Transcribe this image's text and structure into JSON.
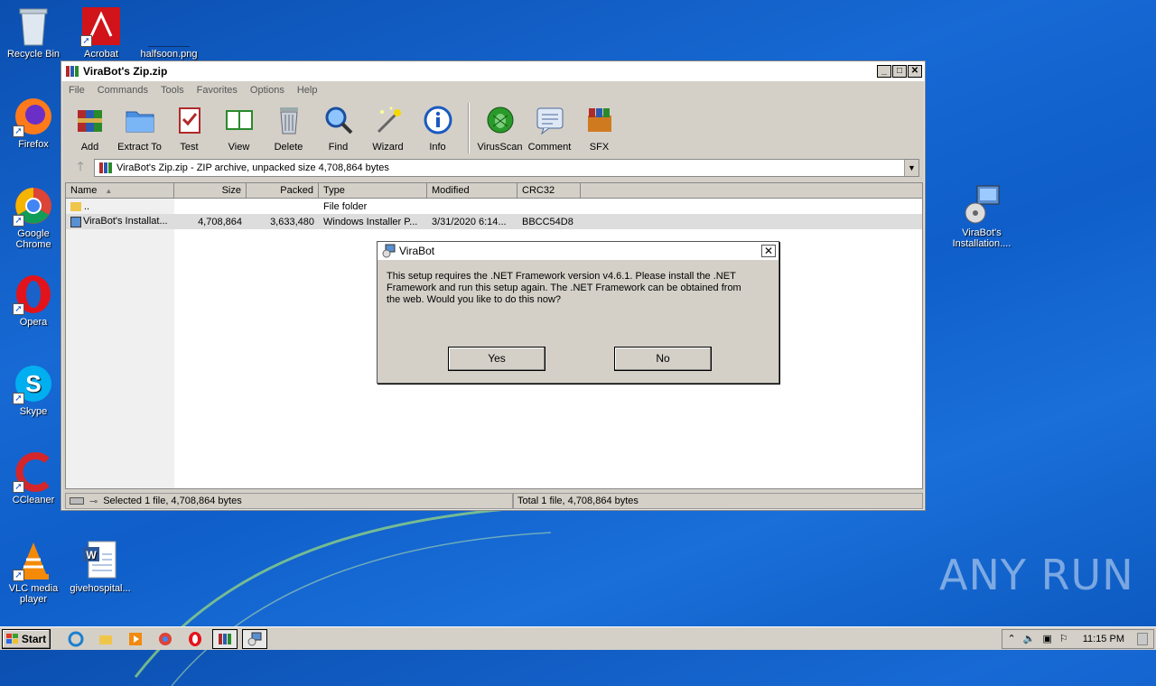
{
  "desktop": {
    "icons": [
      {
        "label": "Recycle Bin"
      },
      {
        "label": "Acrobat"
      },
      {
        "label": "halfsoon.png"
      },
      {
        "label": "Firefox"
      },
      {
        "label": "Google Chrome"
      },
      {
        "label": "Opera"
      },
      {
        "label": "Skype"
      },
      {
        "label": "CCleaner"
      },
      {
        "label": "VLC media player"
      },
      {
        "label": "givehospital..."
      },
      {
        "label": "ViraBot's Installation...."
      }
    ],
    "watermark": "ANY RUN"
  },
  "window": {
    "title": "ViraBot's Zip.zip",
    "menu": [
      "File",
      "Commands",
      "Tools",
      "Favorites",
      "Options",
      "Help"
    ],
    "toolbar": [
      {
        "label": "Add",
        "icon": "add-archive-icon"
      },
      {
        "label": "Extract To",
        "icon": "folder-icon"
      },
      {
        "label": "Test",
        "icon": "test-icon"
      },
      {
        "label": "View",
        "icon": "book-icon"
      },
      {
        "label": "Delete",
        "icon": "trash-icon"
      },
      {
        "label": "Find",
        "icon": "magnifier-icon"
      },
      {
        "label": "Wizard",
        "icon": "wand-icon"
      },
      {
        "label": "Info",
        "icon": "info-icon"
      },
      {
        "label": "VirusScan",
        "icon": "bug-icon"
      },
      {
        "label": "Comment",
        "icon": "comment-icon"
      },
      {
        "label": "SFX",
        "icon": "sfx-icon"
      }
    ],
    "address": "ViraBot's Zip.zip - ZIP archive, unpacked size 4,708,864 bytes",
    "columns": [
      "Name",
      "Size",
      "Packed",
      "Type",
      "Modified",
      "CRC32"
    ],
    "rows": [
      {
        "name": "..",
        "size": "",
        "packed": "",
        "type": "File folder",
        "modified": "",
        "crc": ""
      },
      {
        "name": "ViraBot's Installat...",
        "size": "4,708,864",
        "packed": "3,633,480",
        "type": "Windows Installer P...",
        "modified": "3/31/2020 6:14...",
        "crc": "BBCC54D8"
      }
    ],
    "status_left": "Selected 1 file, 4,708,864 bytes",
    "status_right": "Total 1 file, 4,708,864 bytes"
  },
  "dialog": {
    "title": "ViraBot",
    "message": "This setup requires the .NET Framework version v4.6.1.  Please install the .NET Framework and run this setup again.  The .NET Framework can be obtained from the web.  Would you like to do this now?",
    "yes": "Yes",
    "no": "No"
  },
  "taskbar": {
    "start": "Start",
    "clock": "11:15 PM"
  }
}
